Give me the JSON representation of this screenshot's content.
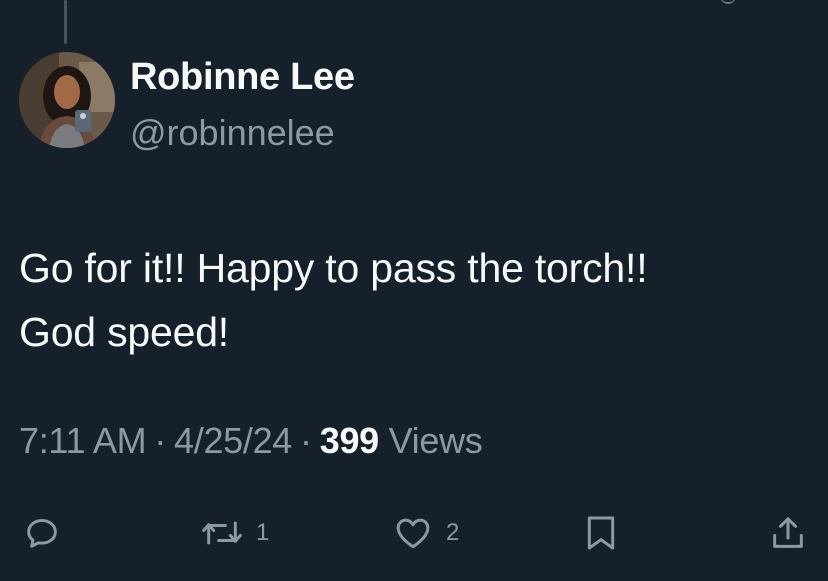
{
  "author": {
    "display_name": "Robinne Lee",
    "handle": "@robinnelee"
  },
  "tweet": {
    "lines": [
      "Go for it!! Happy to pass the torch!!",
      "God speed!"
    ],
    "time": "7:11 AM",
    "date": "4/25/24",
    "separator": "·",
    "views_count": "399",
    "views_label": "Views"
  },
  "actions": {
    "replies": {
      "icon": "reply-icon",
      "count": ""
    },
    "retweets": {
      "icon": "retweet-icon",
      "count": "1"
    },
    "likes": {
      "icon": "heart-icon",
      "count": "2"
    },
    "bookmark": {
      "icon": "bookmark-icon"
    },
    "share": {
      "icon": "share-icon"
    }
  },
  "colors": {
    "background": "#15202b",
    "primary_text": "#f7f9f9",
    "secondary_text": "#8b98a5",
    "thread_line": "#425466"
  }
}
